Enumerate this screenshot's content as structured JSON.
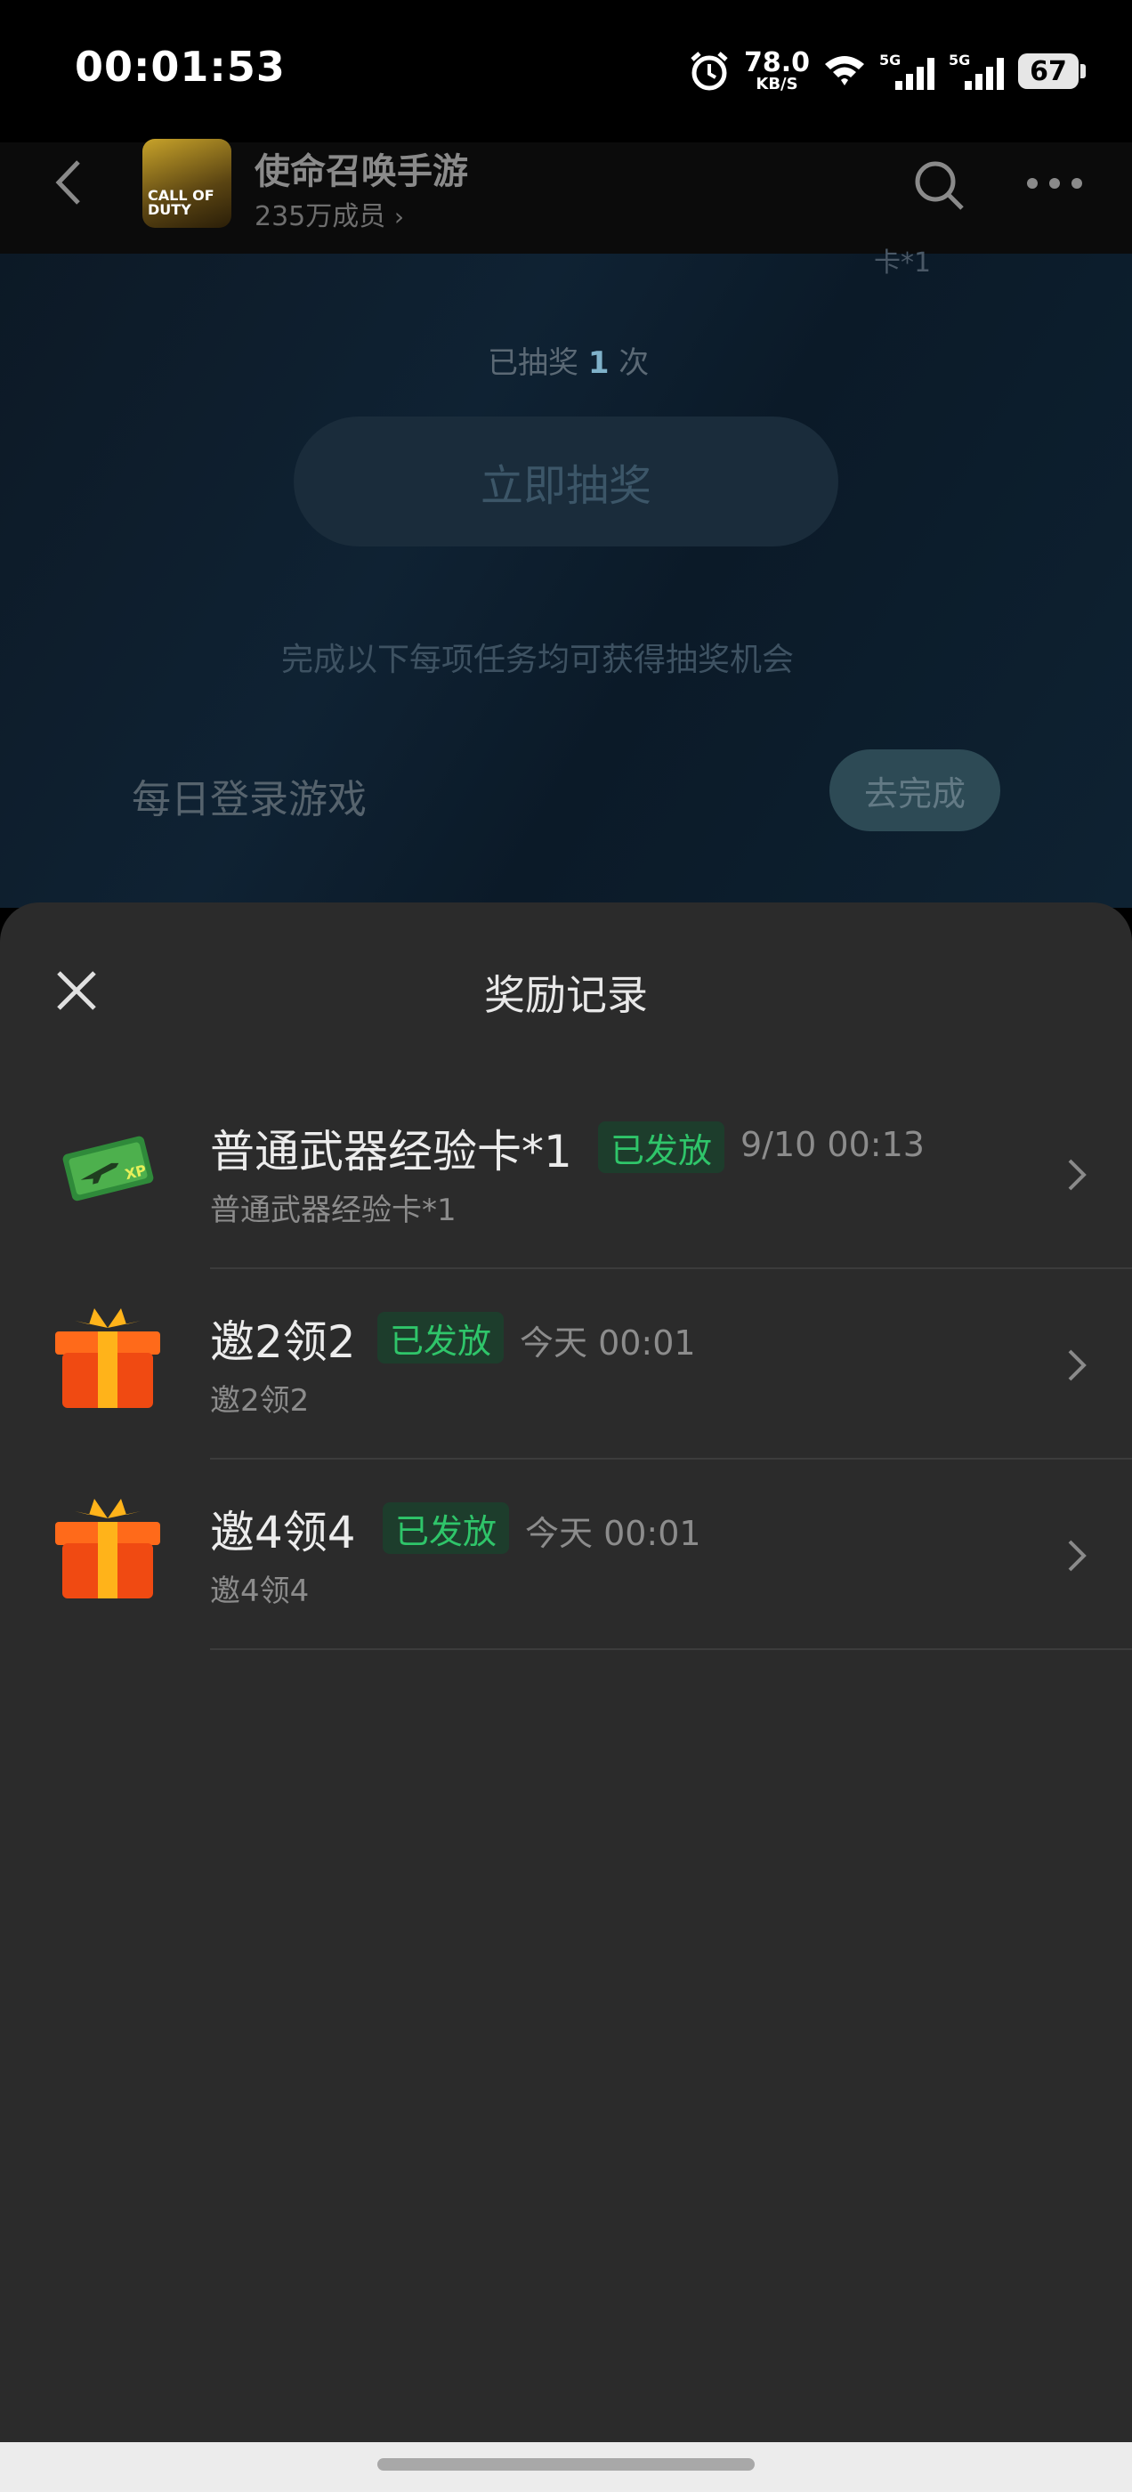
{
  "status_bar": {
    "time": "00:01:53",
    "net_speed_value": "78.0",
    "net_speed_unit": "KB/S",
    "signal1": "5G",
    "signal2": "5G",
    "battery": "67"
  },
  "header": {
    "group_name": "使命召唤手游",
    "member_count": "235万成员",
    "logo_text": "CALL OF DUTY"
  },
  "background_page": {
    "fragment": "卡*1",
    "lottery_count_prefix": "已抽奖",
    "lottery_count_value": "1",
    "lottery_count_suffix": "次",
    "draw_button": "立即抽奖",
    "task_tip": "完成以下每项任务均可获得抽奖机会",
    "task_name": "每日登录游戏",
    "task_button": "去完成"
  },
  "sheet": {
    "title": "奖励记录",
    "records": [
      {
        "name": "普通武器经验卡*1",
        "status": "已发放",
        "date": "9/10 00:13",
        "desc": "普通武器经验卡*1",
        "icon": "weapon-xp-card-icon"
      },
      {
        "name": "邀2领2",
        "status": "已发放",
        "date": "今天 00:01",
        "desc": "邀2领2",
        "icon": "gift-box-icon"
      },
      {
        "name": "邀4领4",
        "status": "已发放",
        "date": "今天 00:01",
        "desc": "邀4领4",
        "icon": "gift-box-icon"
      }
    ]
  },
  "colors": {
    "sheet_bg": "#2b2b2b",
    "badge_text": "#2fc56a",
    "badge_bg": "#1d3d2c"
  }
}
